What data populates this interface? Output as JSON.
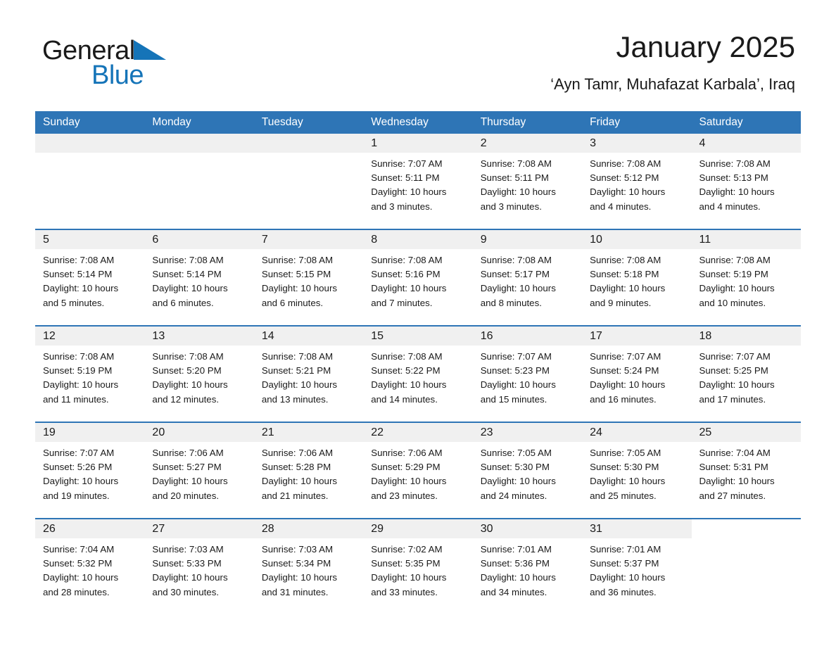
{
  "brand": {
    "name_part1": "General",
    "name_part2": "Blue",
    "accent_color": "#1574b8"
  },
  "header": {
    "month_title": "January 2025",
    "location": "‘Ayn Tamr, Muhafazat Karbala’, Iraq"
  },
  "calendar": {
    "header_color": "#2e75b6",
    "daynum_strip_color": "#f0f0f0",
    "weekday_headers": [
      "Sunday",
      "Monday",
      "Tuesday",
      "Wednesday",
      "Thursday",
      "Friday",
      "Saturday"
    ],
    "weeks": [
      [
        {
          "day": "",
          "lines": []
        },
        {
          "day": "",
          "lines": []
        },
        {
          "day": "",
          "lines": []
        },
        {
          "day": "1",
          "lines": [
            "Sunrise: 7:07 AM",
            "Sunset: 5:11 PM",
            "Daylight: 10 hours",
            "and 3 minutes."
          ]
        },
        {
          "day": "2",
          "lines": [
            "Sunrise: 7:08 AM",
            "Sunset: 5:11 PM",
            "Daylight: 10 hours",
            "and 3 minutes."
          ]
        },
        {
          "day": "3",
          "lines": [
            "Sunrise: 7:08 AM",
            "Sunset: 5:12 PM",
            "Daylight: 10 hours",
            "and 4 minutes."
          ]
        },
        {
          "day": "4",
          "lines": [
            "Sunrise: 7:08 AM",
            "Sunset: 5:13 PM",
            "Daylight: 10 hours",
            "and 4 minutes."
          ]
        }
      ],
      [
        {
          "day": "5",
          "lines": [
            "Sunrise: 7:08 AM",
            "Sunset: 5:14 PM",
            "Daylight: 10 hours",
            "and 5 minutes."
          ]
        },
        {
          "day": "6",
          "lines": [
            "Sunrise: 7:08 AM",
            "Sunset: 5:14 PM",
            "Daylight: 10 hours",
            "and 6 minutes."
          ]
        },
        {
          "day": "7",
          "lines": [
            "Sunrise: 7:08 AM",
            "Sunset: 5:15 PM",
            "Daylight: 10 hours",
            "and 6 minutes."
          ]
        },
        {
          "day": "8",
          "lines": [
            "Sunrise: 7:08 AM",
            "Sunset: 5:16 PM",
            "Daylight: 10 hours",
            "and 7 minutes."
          ]
        },
        {
          "day": "9",
          "lines": [
            "Sunrise: 7:08 AM",
            "Sunset: 5:17 PM",
            "Daylight: 10 hours",
            "and 8 minutes."
          ]
        },
        {
          "day": "10",
          "lines": [
            "Sunrise: 7:08 AM",
            "Sunset: 5:18 PM",
            "Daylight: 10 hours",
            "and 9 minutes."
          ]
        },
        {
          "day": "11",
          "lines": [
            "Sunrise: 7:08 AM",
            "Sunset: 5:19 PM",
            "Daylight: 10 hours",
            "and 10 minutes."
          ]
        }
      ],
      [
        {
          "day": "12",
          "lines": [
            "Sunrise: 7:08 AM",
            "Sunset: 5:19 PM",
            "Daylight: 10 hours",
            "and 11 minutes."
          ]
        },
        {
          "day": "13",
          "lines": [
            "Sunrise: 7:08 AM",
            "Sunset: 5:20 PM",
            "Daylight: 10 hours",
            "and 12 minutes."
          ]
        },
        {
          "day": "14",
          "lines": [
            "Sunrise: 7:08 AM",
            "Sunset: 5:21 PM",
            "Daylight: 10 hours",
            "and 13 minutes."
          ]
        },
        {
          "day": "15",
          "lines": [
            "Sunrise: 7:08 AM",
            "Sunset: 5:22 PM",
            "Daylight: 10 hours",
            "and 14 minutes."
          ]
        },
        {
          "day": "16",
          "lines": [
            "Sunrise: 7:07 AM",
            "Sunset: 5:23 PM",
            "Daylight: 10 hours",
            "and 15 minutes."
          ]
        },
        {
          "day": "17",
          "lines": [
            "Sunrise: 7:07 AM",
            "Sunset: 5:24 PM",
            "Daylight: 10 hours",
            "and 16 minutes."
          ]
        },
        {
          "day": "18",
          "lines": [
            "Sunrise: 7:07 AM",
            "Sunset: 5:25 PM",
            "Daylight: 10 hours",
            "and 17 minutes."
          ]
        }
      ],
      [
        {
          "day": "19",
          "lines": [
            "Sunrise: 7:07 AM",
            "Sunset: 5:26 PM",
            "Daylight: 10 hours",
            "and 19 minutes."
          ]
        },
        {
          "day": "20",
          "lines": [
            "Sunrise: 7:06 AM",
            "Sunset: 5:27 PM",
            "Daylight: 10 hours",
            "and 20 minutes."
          ]
        },
        {
          "day": "21",
          "lines": [
            "Sunrise: 7:06 AM",
            "Sunset: 5:28 PM",
            "Daylight: 10 hours",
            "and 21 minutes."
          ]
        },
        {
          "day": "22",
          "lines": [
            "Sunrise: 7:06 AM",
            "Sunset: 5:29 PM",
            "Daylight: 10 hours",
            "and 23 minutes."
          ]
        },
        {
          "day": "23",
          "lines": [
            "Sunrise: 7:05 AM",
            "Sunset: 5:30 PM",
            "Daylight: 10 hours",
            "and 24 minutes."
          ]
        },
        {
          "day": "24",
          "lines": [
            "Sunrise: 7:05 AM",
            "Sunset: 5:30 PM",
            "Daylight: 10 hours",
            "and 25 minutes."
          ]
        },
        {
          "day": "25",
          "lines": [
            "Sunrise: 7:04 AM",
            "Sunset: 5:31 PM",
            "Daylight: 10 hours",
            "and 27 minutes."
          ]
        }
      ],
      [
        {
          "day": "26",
          "lines": [
            "Sunrise: 7:04 AM",
            "Sunset: 5:32 PM",
            "Daylight: 10 hours",
            "and 28 minutes."
          ]
        },
        {
          "day": "27",
          "lines": [
            "Sunrise: 7:03 AM",
            "Sunset: 5:33 PM",
            "Daylight: 10 hours",
            "and 30 minutes."
          ]
        },
        {
          "day": "28",
          "lines": [
            "Sunrise: 7:03 AM",
            "Sunset: 5:34 PM",
            "Daylight: 10 hours",
            "and 31 minutes."
          ]
        },
        {
          "day": "29",
          "lines": [
            "Sunrise: 7:02 AM",
            "Sunset: 5:35 PM",
            "Daylight: 10 hours",
            "and 33 minutes."
          ]
        },
        {
          "day": "30",
          "lines": [
            "Sunrise: 7:01 AM",
            "Sunset: 5:36 PM",
            "Daylight: 10 hours",
            "and 34 minutes."
          ]
        },
        {
          "day": "31",
          "lines": [
            "Sunrise: 7:01 AM",
            "Sunset: 5:37 PM",
            "Daylight: 10 hours",
            "and 36 minutes."
          ]
        },
        {
          "day": "",
          "lines": []
        }
      ]
    ]
  }
}
